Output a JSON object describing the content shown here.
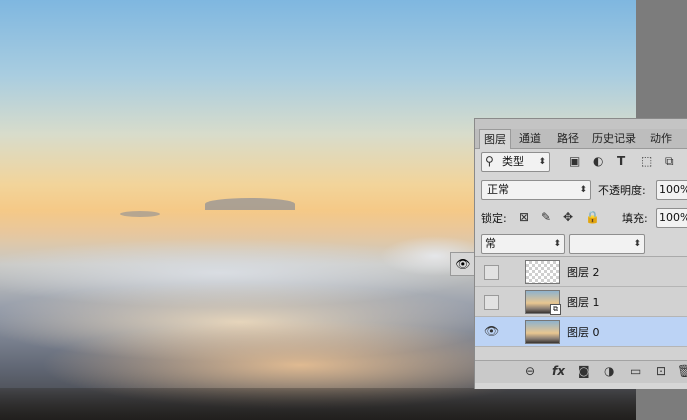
{
  "tabs": [
    "图层",
    "通道",
    "路径",
    "历史记录",
    "动作"
  ],
  "filter": {
    "label": "类型",
    "search_icon": "search-icon"
  },
  "blend": {
    "mode": "正常",
    "opacity_label": "不透明度:",
    "opacity_value": "100%"
  },
  "lock": {
    "label": "锁定:",
    "fill_label": "填充:",
    "fill_value": "100%"
  },
  "sub": {
    "left": "常"
  },
  "layers": [
    {
      "name": "图层 2",
      "visible": false,
      "selected": false,
      "thumb": "transparent"
    },
    {
      "name": "图层 1",
      "visible": false,
      "selected": false,
      "thumb": "photo-smart"
    },
    {
      "name": "图层 0",
      "visible": true,
      "selected": true,
      "thumb": "photo"
    }
  ],
  "bottom_icons": [
    "link-icon",
    "fx-icon",
    "mask-icon",
    "adjustment-icon",
    "folder-icon",
    "new-layer-icon",
    "trash-icon"
  ]
}
